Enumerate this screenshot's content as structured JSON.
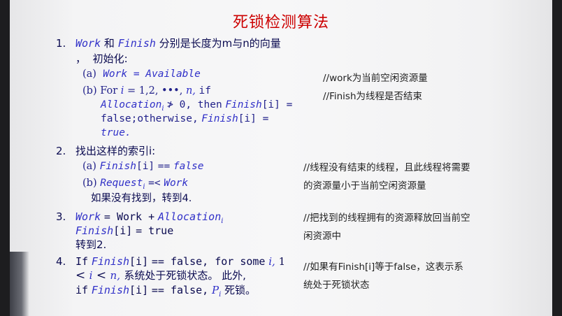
{
  "title": "死锁检测算法",
  "steps": {
    "s1": {
      "num": "1.",
      "work": "Work",
      "and": "和",
      "finish": "Finish",
      "desc": "分别是长度为m与n的向量",
      "comma": "，",
      "init": "初始化:",
      "a_label": "(a)",
      "a_text": "Work = Available",
      "b_label": "(b)",
      "b_for": "For",
      "b_i": "i",
      "b_range": "= 1,2, •••,",
      "b_n": "n,",
      "b_if": "if",
      "b_alloc": "Allocation",
      "b_alloc_sub": "i",
      "b_cond": "≯ 0, then",
      "b_finish1": "Finish",
      "b_idx1": "[i] =",
      "b_false": "false;otherwise,",
      "b_finish2": "Finish",
      "b_idx2": "[i] =",
      "b_true": "true."
    },
    "s2": {
      "num": "2.",
      "text": "找出这样的索引i:",
      "a_label": "(a)",
      "a_finish": "Finish",
      "a_idx": "[i]",
      "a_eq": "==",
      "a_false": "false",
      "b_label": "(b)",
      "b_req": "Request",
      "b_req_sub": "i",
      "b_op": "=<",
      "b_work": "Work",
      "notfound": "如果没有找到，转到4."
    },
    "s3": {
      "num": "3.",
      "l1_work": "Work",
      "l1_eq": "= Work +",
      "l1_alloc": "Allocation",
      "l1_sub": "i",
      "l2_finish": "Finish",
      "l2_idx": "[i]",
      "l2_eq": "= true",
      "l3": "转到2."
    },
    "s4": {
      "num": "4.",
      "l1_if": "If",
      "l1_finish": "Finish",
      "l1_idx": "[i]",
      "l1_rest": "== false, for some",
      "l1_i": "i,",
      "l1_one": "1",
      "l2_lt1": "<",
      "l2_i": "i",
      "l2_lt2": "<",
      "l2_n": "n,",
      "l2_text": "系统处于死锁状态。 此外,",
      "l3_if": "if",
      "l3_finish": "Finish",
      "l3_idx": "[i]",
      "l3_eq": "== false,",
      "l3_p": "P",
      "l3_psub": "i",
      "l3_text": "死锁。"
    }
  },
  "comments": {
    "c1": "//work为当前空闲资源量",
    "c2": "//Finish为线程是否结束",
    "c3a": "//线程没有结束的线程，且此线程将需要",
    "c3b": "的资源量小于当前空闲资源量",
    "c4a": "//把找到的线程拥有的资源释放回当前空",
    "c4b": "闲资源中",
    "c5a": "//如果有Finish[i]等于false，这表示系",
    "c5b": "统处于死锁状态"
  }
}
